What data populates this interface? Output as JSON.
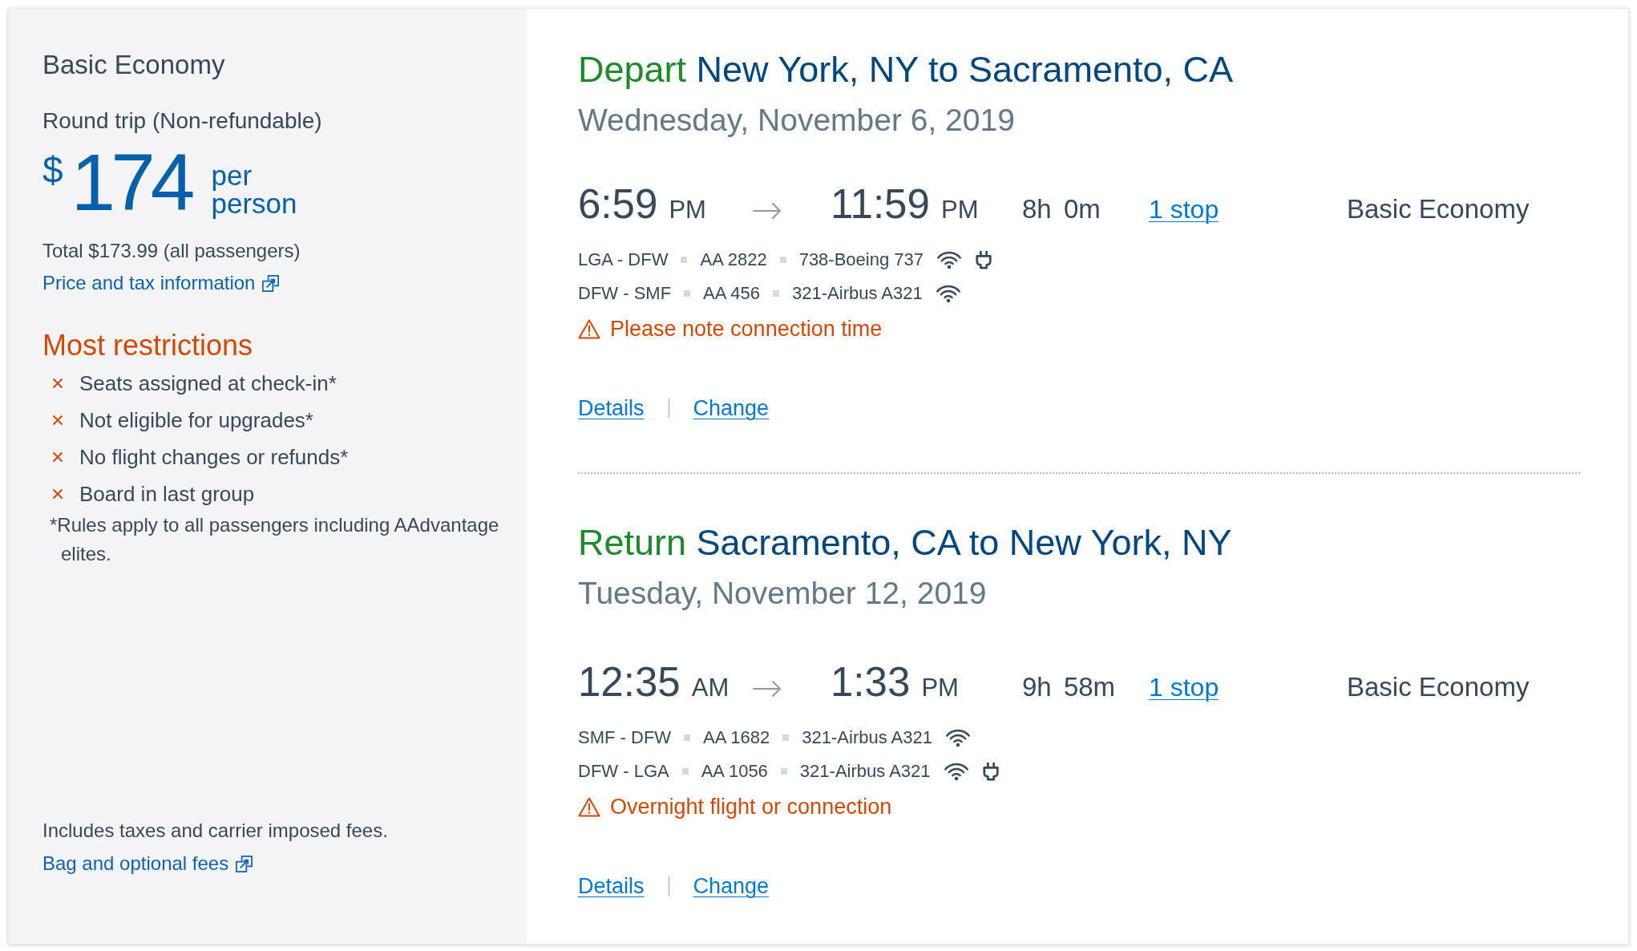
{
  "fare": {
    "title": "Basic Economy",
    "trip_type": "Round trip (Non-refundable)",
    "price": {
      "currency": "$",
      "amount": "174",
      "unit": "per person"
    },
    "total": "Total $173.99 (all passengers)",
    "price_info_link": "Price and tax information",
    "restrictions": {
      "heading": "Most restrictions",
      "items": [
        "Seats assigned at check-in*",
        "Not eligible for upgrades*",
        "No flight changes or refunds*",
        "Board in last group"
      ],
      "footnote": "*Rules apply to all passengers including AAdvantage elites."
    },
    "includes_note": "Includes taxes and carrier imposed fees.",
    "fees_link": "Bag and optional fees"
  },
  "slices": [
    {
      "direction": "Depart",
      "route": "New York, NY to Sacramento, CA",
      "date": "Wednesday, November 6, 2019",
      "departure": {
        "time": "6:59",
        "period": "PM"
      },
      "arrival": {
        "time": "11:59",
        "period": "PM"
      },
      "duration": {
        "hours": "8h",
        "minutes": "0m"
      },
      "stops_link": "1 stop",
      "cabin": "Basic Economy",
      "segments": [
        {
          "route": "LGA - DFW",
          "flight": "AA 2822",
          "aircraft": "738-Boeing 737",
          "wifi": true,
          "power": true
        },
        {
          "route": "DFW - SMF",
          "flight": "AA 456",
          "aircraft": "321-Airbus A321",
          "wifi": true,
          "power": false
        }
      ],
      "notice": "Please note connection time",
      "details_link": "Details",
      "change_link": "Change"
    },
    {
      "direction": "Return",
      "route": "Sacramento, CA to New York, NY",
      "date": "Tuesday, November 12, 2019",
      "departure": {
        "time": "12:35",
        "period": "AM"
      },
      "arrival": {
        "time": "1:33",
        "period": "PM"
      },
      "duration": {
        "hours": "9h",
        "minutes": "58m"
      },
      "stops_link": "1 stop",
      "cabin": "Basic Economy",
      "segments": [
        {
          "route": "SMF - DFW",
          "flight": "AA 1682",
          "aircraft": "321-Airbus A321",
          "wifi": true,
          "power": false
        },
        {
          "route": "DFW - LGA",
          "flight": "AA 1056",
          "aircraft": "321-Airbus A321",
          "wifi": true,
          "power": true
        }
      ],
      "notice": "Overnight flight or connection",
      "details_link": "Details",
      "change_link": "Change"
    }
  ]
}
